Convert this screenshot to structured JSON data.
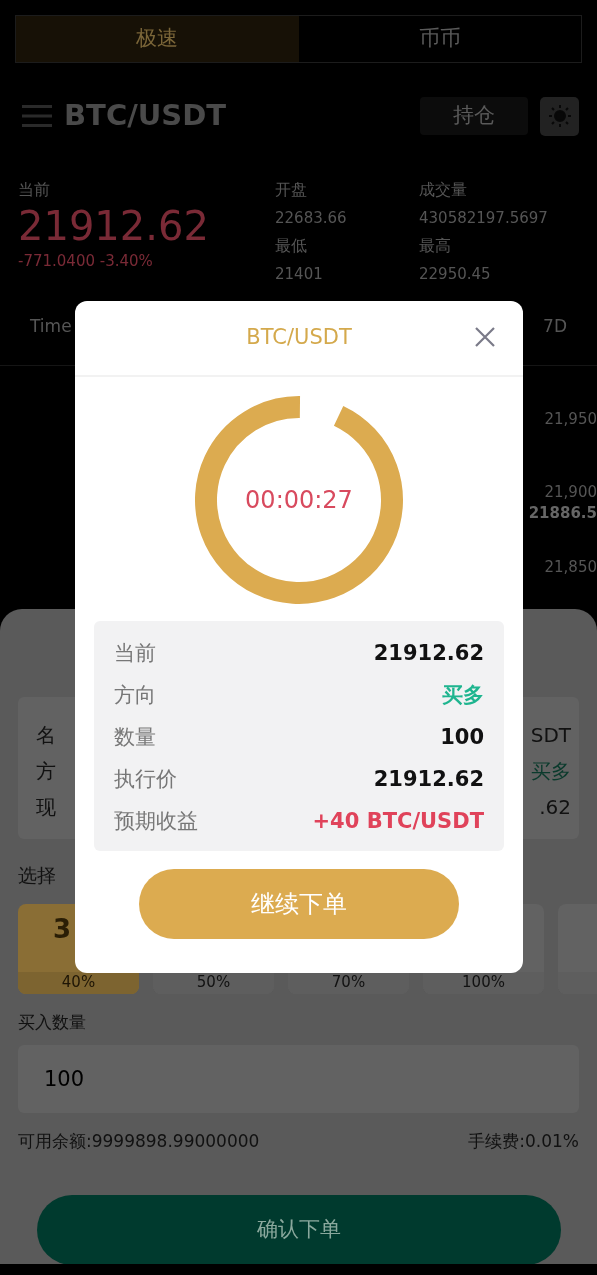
{
  "mode_tabs": [
    {
      "label": "极速",
      "selected": true
    },
    {
      "label": "币币",
      "selected": false
    }
  ],
  "header": {
    "title": "BTC/USDT",
    "positions_button": "持仓"
  },
  "ticker": {
    "current_label": "当前",
    "price": "21912.62",
    "change": "-771.0400 -3.40%",
    "stats": [
      {
        "label": "开盘",
        "value": "22683.66"
      },
      {
        "label": "成交量",
        "value": "430582197.5697"
      },
      {
        "label": "最低",
        "value": "21401"
      },
      {
        "label": "最高",
        "value": "22950.45"
      }
    ]
  },
  "intervals": [
    {
      "label": "Time"
    },
    {
      "label": "7D"
    }
  ],
  "price_axis": [
    {
      "label": "21,950",
      "kind": "tick"
    },
    {
      "label": "21,900",
      "kind": "tick"
    },
    {
      "label": "21886.5",
      "kind": "current"
    },
    {
      "label": "21,850",
      "kind": "tick"
    }
  ],
  "order_sheet": {
    "info_labels": [
      "名",
      "方",
      "现"
    ],
    "info_values": [
      {
        "text": "SDT",
        "kind": "plain"
      },
      {
        "text": "买多",
        "kind": "buy"
      },
      {
        "text": ".62",
        "kind": "plain"
      }
    ],
    "duration_label": "选择",
    "durations": [
      {
        "time": "3",
        "rate": "40%",
        "selected": true
      },
      {
        "rate": "50%",
        "selected": false
      },
      {
        "rate": "70%",
        "selected": false
      },
      {
        "rate": "100%",
        "selected": false
      },
      {
        "selected": false
      }
    ],
    "amount_label": "买入数量",
    "amount": "100",
    "balance": "可用余额:9999898.99000000",
    "fee": "手续费:0.01%",
    "confirm_button": "确认下单"
  },
  "modal": {
    "title": "BTC/USDT",
    "countdown": "00:00:27",
    "level": 0.93,
    "rows": [
      {
        "label": "当前",
        "value": "21912.62",
        "kind": "plain"
      },
      {
        "label": "方向",
        "value": "买多",
        "kind": "buy"
      },
      {
        "label": "数量",
        "value": "100",
        "kind": "plain"
      },
      {
        "label": "执行价",
        "value": "21912.62",
        "kind": "plain"
      },
      {
        "label": "预期收益",
        "value": "+40 BTC/USDT",
        "kind": "profit"
      }
    ],
    "continue_button": "继续下单"
  }
}
